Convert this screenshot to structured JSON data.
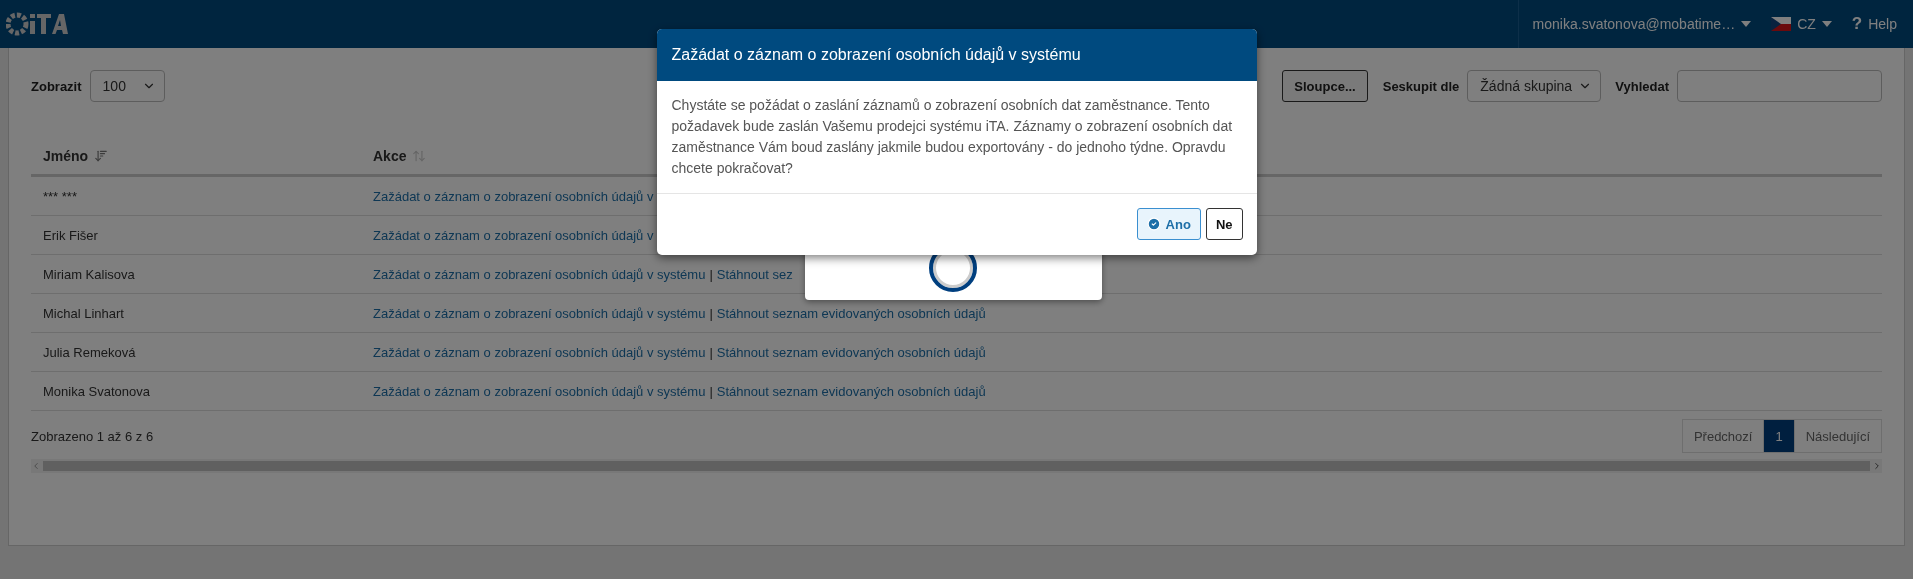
{
  "header": {
    "user": "monika.svatonova@mobatime…",
    "language": "CZ",
    "help_icon": "?",
    "help": "Help"
  },
  "toolbar": {
    "show_label": "Zobrazit",
    "page_size": "100",
    "columns_button": "Sloupce...",
    "group_label": "Seskupit dle",
    "group_value": "Žádná skupina",
    "search_label": "Vyhledat"
  },
  "table": {
    "columns": [
      {
        "label": "Jméno",
        "sorted": true
      },
      {
        "label": "Akce",
        "sorted": false
      }
    ],
    "rows": [
      {
        "name": "*** ***",
        "actions": [
          {
            "label": "Zažádat o záznam o zobrazení osobních údajů v"
          }
        ]
      },
      {
        "name": "Erik Fišer",
        "actions": [
          {
            "label": "Zažádat o záznam o zobrazení osobních údajů v"
          }
        ]
      },
      {
        "name": "Miriam Kalisova",
        "actions": [
          {
            "label": "Zažádat o záznam o zobrazení osobních údajů v systému"
          },
          {
            "label": "Stáhnout sez"
          }
        ],
        "separator": "|"
      },
      {
        "name": "Michal Linhart",
        "actions": [
          {
            "label": "Zažádat o záznam o zobrazení osobních údajů v systému"
          },
          {
            "label": "Stáhnout seznam evidovaných osobních údajů"
          }
        ],
        "separator": "|"
      },
      {
        "name": "Julia Remeková",
        "actions": [
          {
            "label": "Zažádat o záznam o zobrazení osobních údajů v systému"
          },
          {
            "label": "Stáhnout seznam evidovaných osobních údajů"
          }
        ],
        "separator": "|"
      },
      {
        "name": "Monika Svatonova",
        "actions": [
          {
            "label": "Zažádat o záznam o zobrazení osobních údajů v systému"
          },
          {
            "label": "Stáhnout seznam evidovaných osobních údajů"
          }
        ],
        "separator": "|"
      }
    ]
  },
  "summary": "Zobrazeno 1 až 6 z 6",
  "pagination": [
    {
      "label": "Předchozí",
      "selected": false
    },
    {
      "label": "1",
      "selected": true
    },
    {
      "label": "Následující",
      "selected": false
    }
  ],
  "dialog": {
    "title": "Zažádat o záznam o zobrazení osobních údajů v systému",
    "message": "Chystáte se požádat o zaslání záznamů o zobrazení osobních dat zaměstnance. Tento požadavek bude zaslán Vašemu prodejci systému iTA. Záznamy o zobrazení osobních dat zaměstnance Vám boud zaslány jakmile budou exportovány - do jednoho týdne. Opravdu chcete pokračovat?",
    "buttons": [
      {
        "label": "Ano",
        "kind": "primary"
      },
      {
        "label": "Ne",
        "kind": "default"
      }
    ]
  }
}
